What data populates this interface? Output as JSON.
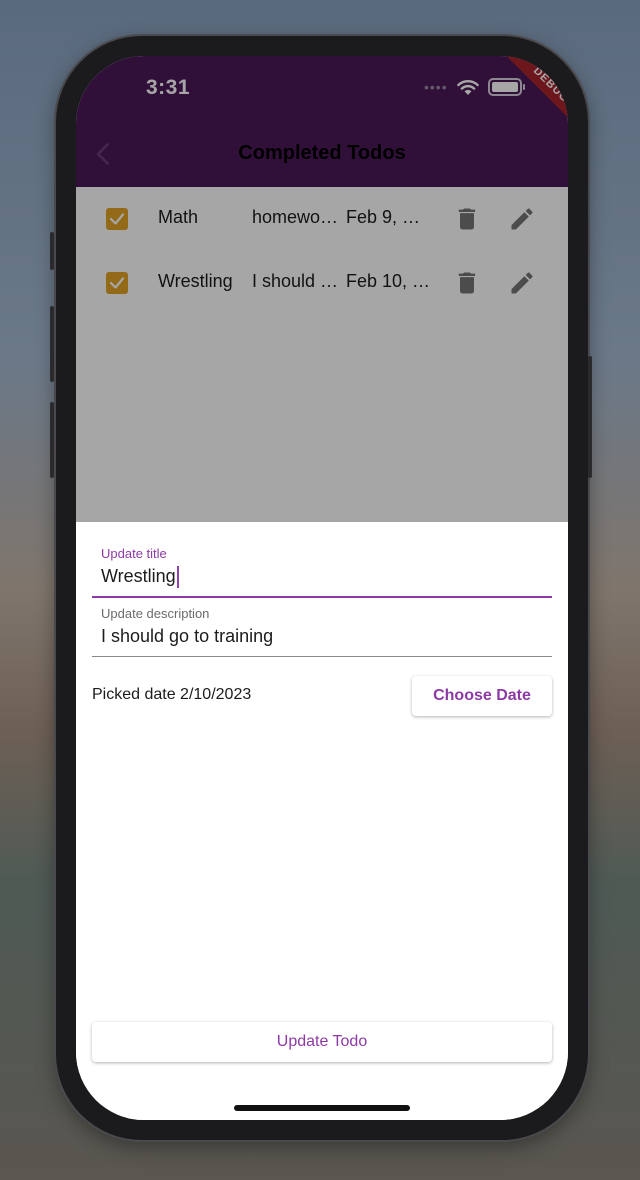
{
  "status_bar": {
    "time": "3:31",
    "dots": "••••"
  },
  "debug_banner": "DEBUG",
  "app_bar": {
    "title": "Completed Todos"
  },
  "todos": [
    {
      "title": "Math",
      "description": "homewo…",
      "date": "Feb 9, …",
      "checked": true
    },
    {
      "title": "Wrestling",
      "description": "I should …",
      "date": "Feb 10, …",
      "checked": true
    }
  ],
  "sheet": {
    "title_field": {
      "label": "Update title",
      "value": "Wrestling"
    },
    "description_field": {
      "label": "Update description",
      "value": "I should go to training"
    },
    "picked_date_text": "Picked date 2/10/2023",
    "choose_date_label": "Choose Date",
    "update_button_label": "Update Todo"
  },
  "colors": {
    "app_bar": "#4a1a57",
    "accent": "#8e3aa6",
    "checkbox": "#e0a325"
  },
  "icons": [
    "back-icon",
    "wifi-icon",
    "battery-icon",
    "check-icon",
    "delete-icon",
    "edit-icon"
  ]
}
